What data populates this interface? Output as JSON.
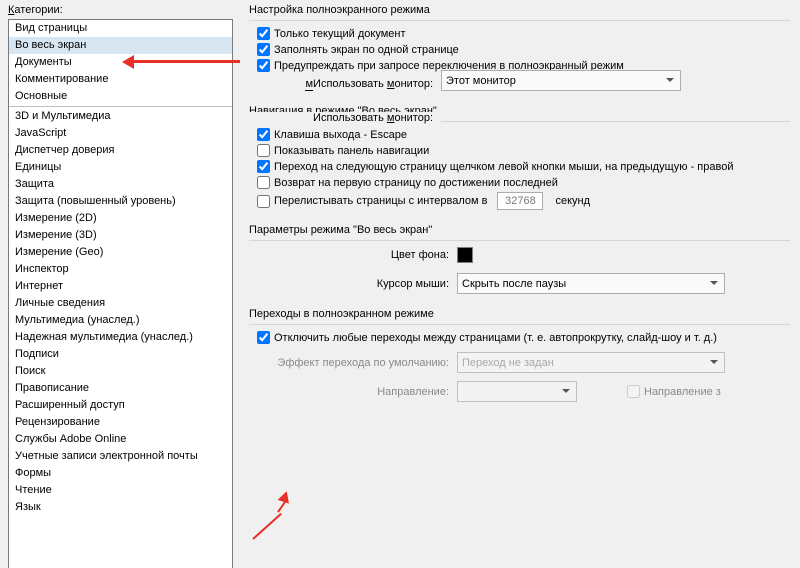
{
  "leftLabel": "Категории:",
  "categories": {
    "top": [
      "Вид страницы",
      "Во весь экран",
      "Документы",
      "Комментирование",
      "Основные"
    ],
    "bottom": [
      "3D и Мультимедиа",
      "JavaScript",
      "Диспетчер доверия",
      "Единицы",
      "Защита",
      "Защита (повышенный уровень)",
      "Измерение (2D)",
      "Измерение (3D)",
      "Измерение (Geo)",
      "Инспектор",
      "Интернет",
      "Личные сведения",
      "Мультимедиа (унаслед.)",
      "Надежная мультимедиа (унаслед.)",
      "Подписи",
      "Поиск",
      "Правописание",
      "Расширенный доступ",
      "Рецензирование",
      "Службы Adobe Online",
      "Учетные записи электронной почты",
      "Формы",
      "Чтение",
      "Язык"
    ]
  },
  "grp1": {
    "title": "Настройка полноэкранного режима",
    "opt1": "Только текущий документ",
    "opt2": "Заполнять экран по одной странице",
    "opt3": "Предупреждать при запросе переключения в полноэкранный режим",
    "monitorLbl": "Использовать монитор:",
    "monitorVal": "Этот монитор"
  },
  "grp2": {
    "title": "Навигация в режиме \"Во весь экран\"",
    "opt1": "Клавиша выхода - Escape",
    "opt2": "Показывать панель навигации",
    "opt3": "Переход на следующую страницу щелчком левой кнопки мыши, на предыдущую - правой",
    "opt4": "Возврат на первую страницу по достижении последней",
    "opt5": "Перелистывать страницы с интервалом в",
    "interval": "32768",
    "sec": "секунд"
  },
  "grp3": {
    "title": "Параметры режима \"Во весь экран\"",
    "bgLbl": "Цвет фона:",
    "cursorLbl": "Курсор мыши:",
    "cursorVal": "Скрыть после паузы"
  },
  "grp4": {
    "title": "Переходы в полноэкранном режиме",
    "opt1": "Отключить любые переходы между страницами (т. е. автопрокрутку, слайд-шоу и т. д.)",
    "effectLbl": "Эффект перехода по умолчанию:",
    "effectVal": "Переход не задан",
    "dirLbl": "Направление:",
    "dirChk": "Направление з"
  }
}
